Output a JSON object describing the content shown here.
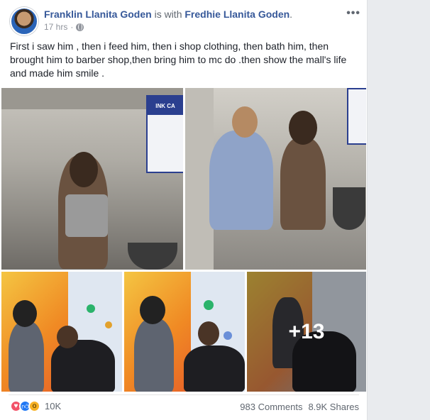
{
  "post": {
    "author": "Franklin Llanita Goden",
    "with_text": "is with",
    "tagged": "Fredhie Llanita Goden",
    "tagged_suffix": ".",
    "time": "17 hrs",
    "meta_separator": "·",
    "more_label": "•••",
    "text": "First i saw him , then i feed him, then i shop clothing, then bath him, then brought him to barber shop,then bring him to mc do .then show the mall's life and made him smile .",
    "extra_photos_label": "+13",
    "photo_sign_text": "INK CA"
  },
  "footer": {
    "reaction_count": "10K",
    "comments": "983 Comments",
    "shares": "8.9K Shares"
  },
  "colors": {
    "link": "#365899",
    "love": "#f25268",
    "like": "#2078f4",
    "wow": "#f7b125"
  }
}
